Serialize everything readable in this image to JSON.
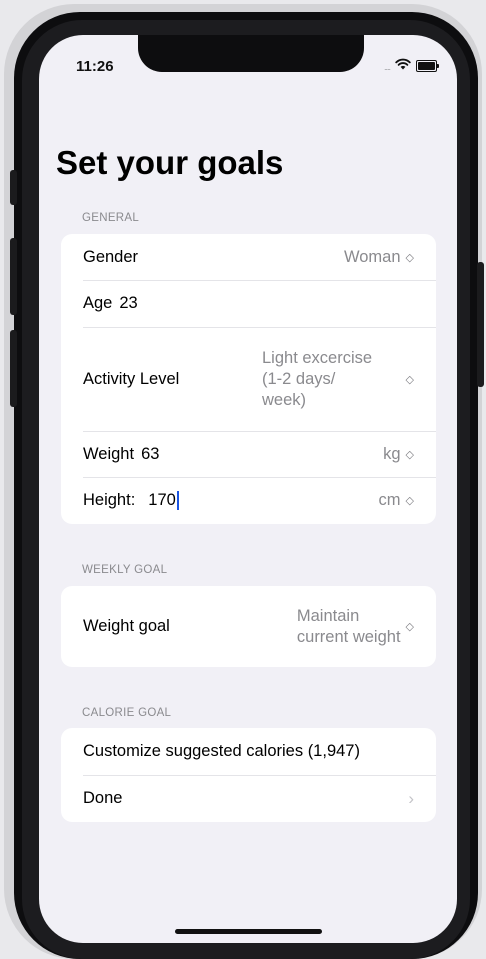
{
  "status_bar": {
    "time": "11:26",
    "signal": "....",
    "wifi_icon": "wifi-icon",
    "battery_icon": "battery-icon"
  },
  "page": {
    "title": "Set your goals"
  },
  "general": {
    "header": "GENERAL",
    "gender": {
      "label": "Gender",
      "value": "Woman"
    },
    "age": {
      "label": "Age",
      "value": "23"
    },
    "activity": {
      "label": "Activity Level",
      "value_line1": "Light excercise",
      "value_line2": "(1-2 days/",
      "value_line3": "week)"
    },
    "weight": {
      "label": "Weight",
      "value": "63",
      "unit": "kg"
    },
    "height": {
      "label": "Height:",
      "value": "170",
      "unit": "cm"
    }
  },
  "weekly_goal": {
    "header": "WEEKLY GOAL",
    "weight_goal": {
      "label": "Weight goal",
      "value_line1": "Maintain",
      "value_line2": "current weight"
    }
  },
  "calorie_goal": {
    "header": "CALORIE GOAL",
    "customize_label": "Customize suggested calories (1,947)",
    "done_label": "Done"
  },
  "colors": {
    "background": "#f1f0f6",
    "card": "#ffffff",
    "secondary_text": "#8a8a8e",
    "cursor": "#1a55e3"
  }
}
